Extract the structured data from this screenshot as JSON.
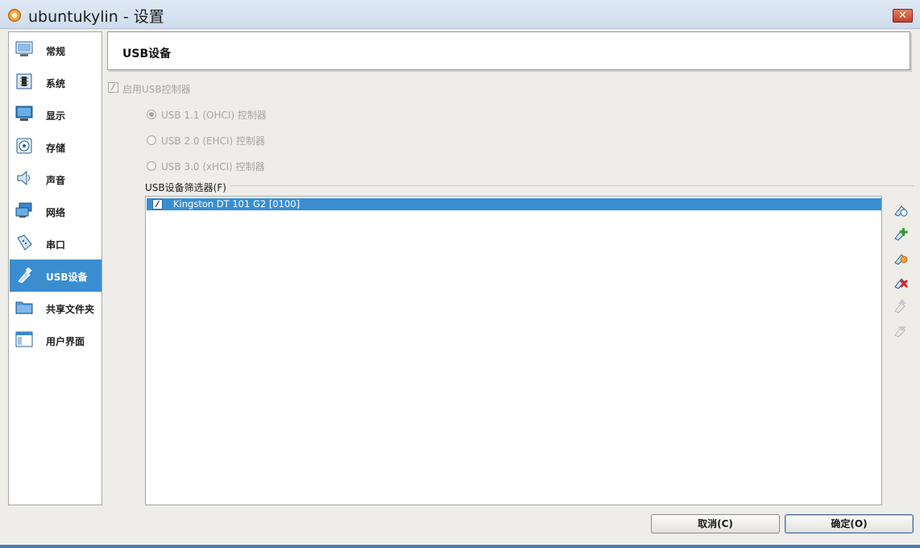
{
  "window": {
    "title": "ubuntukylin - 设置",
    "close_glyph": "✕"
  },
  "nav": {
    "items": [
      {
        "label": "常规",
        "icon": "general-monitor-icon"
      },
      {
        "label": "系统",
        "icon": "chip-icon"
      },
      {
        "label": "显示",
        "icon": "display-icon"
      },
      {
        "label": "存储",
        "icon": "disk-icon"
      },
      {
        "label": "声音",
        "icon": "speaker-icon"
      },
      {
        "label": "网络",
        "icon": "network-icon"
      },
      {
        "label": "串口",
        "icon": "serial-port-icon"
      },
      {
        "label": "USB设备",
        "icon": "usb-icon",
        "active": true
      },
      {
        "label": "共享文件夹",
        "icon": "folder-icon"
      },
      {
        "label": "用户界面",
        "icon": "window-icon"
      }
    ]
  },
  "page": {
    "title": "USB设备"
  },
  "usb": {
    "enable_label": "启用USB控制器",
    "check_glyph": "/",
    "radios": [
      {
        "label": "USB 1.1 (OHCI) 控制器",
        "checked": true
      },
      {
        "label": "USB 2.0 (EHCI) 控制器",
        "checked": false
      },
      {
        "label": "USB 3.0 (xHCI) 控制器",
        "checked": false
      }
    ]
  },
  "filters": {
    "legend": "USB设备筛选器(F)",
    "rows": [
      {
        "label": "Kingston DT 101 G2 [0100]",
        "checked": true
      }
    ],
    "tools": [
      "add-empty-filter-icon",
      "add-device-filter-icon",
      "edit-filter-icon",
      "remove-filter-icon",
      "move-up-icon",
      "move-down-icon"
    ]
  },
  "buttons": {
    "cancel": "取消(C)",
    "ok": "确定(O)"
  },
  "colors": {
    "accent": "#3a8ed0",
    "disabled_text": "#a8a6a2"
  }
}
